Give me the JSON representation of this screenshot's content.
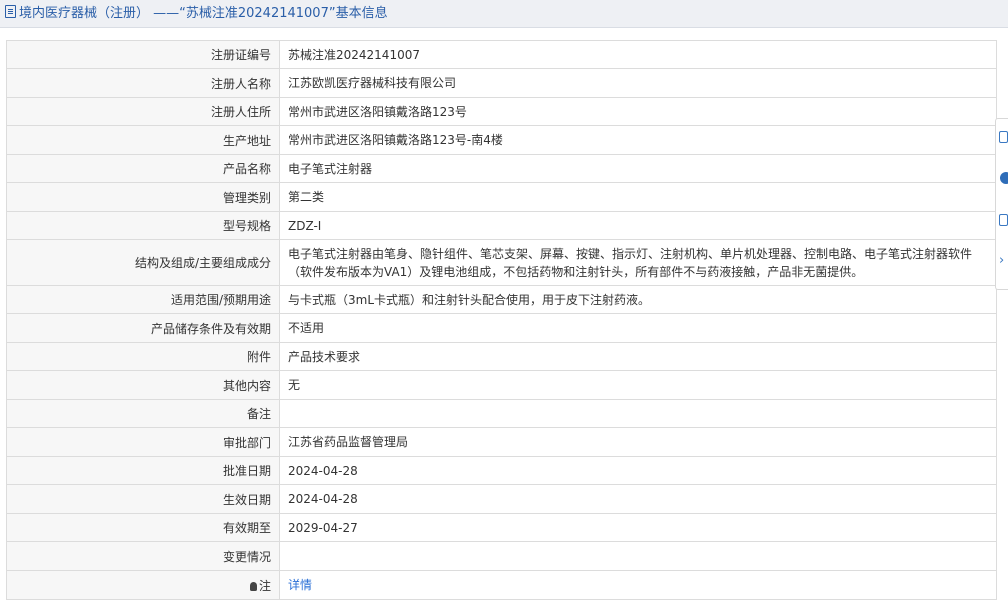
{
  "header": {
    "title": "境内医疗器械（注册） ——“苏械注准20242141007”基本信息"
  },
  "rows": [
    {
      "label": "注册证编号",
      "value": "苏械注准20242141007"
    },
    {
      "label": "注册人名称",
      "value": "江苏欧凯医疗器械科技有限公司"
    },
    {
      "label": "注册人住所",
      "value": "常州市武进区洛阳镇戴洛路123号"
    },
    {
      "label": "生产地址",
      "value": "常州市武进区洛阳镇戴洛路123号-南4楼"
    },
    {
      "label": "产品名称",
      "value": "电子笔式注射器"
    },
    {
      "label": "管理类别",
      "value": "第二类"
    },
    {
      "label": "型号规格",
      "value": "ZDZ-I"
    },
    {
      "label": "结构及组成/主要组成成分",
      "value": "电子笔式注射器由笔身、隐针组件、笔芯支架、屏幕、按键、指示灯、注射机构、单片机处理器、控制电路、电子笔式注射器软件（软件发布版本为VA1）及锂电池组成，不包括药物和注射针头，所有部件不与药液接触，产品非无菌提供。"
    },
    {
      "label": "适用范围/预期用途",
      "value": "与卡式瓶（3mL卡式瓶）和注射针头配合使用，用于皮下注射药液。"
    },
    {
      "label": "产品储存条件及有效期",
      "value": "不适用"
    },
    {
      "label": "附件",
      "value": "产品技术要求"
    },
    {
      "label": "其他内容",
      "value": "无"
    },
    {
      "label": "备注",
      "value": ""
    },
    {
      "label": "审批部门",
      "value": "江苏省药品监督管理局"
    },
    {
      "label": "批准日期",
      "value": "2024-04-28"
    },
    {
      "label": "生效日期",
      "value": "2024-04-28"
    },
    {
      "label": "有效期至",
      "value": "2029-04-27"
    },
    {
      "label": "变更情况",
      "value": ""
    }
  ],
  "note": {
    "label": "注",
    "link_text": "详情"
  },
  "sidebar": {
    "icons": [
      "edit-icon",
      "help-icon",
      "copy-icon",
      "collapse-icon"
    ],
    "accent": "#2e6db8"
  },
  "colors": {
    "title": "#2a5ea8",
    "link": "#2a6fd6",
    "label_bg": "#f7f7f7"
  }
}
